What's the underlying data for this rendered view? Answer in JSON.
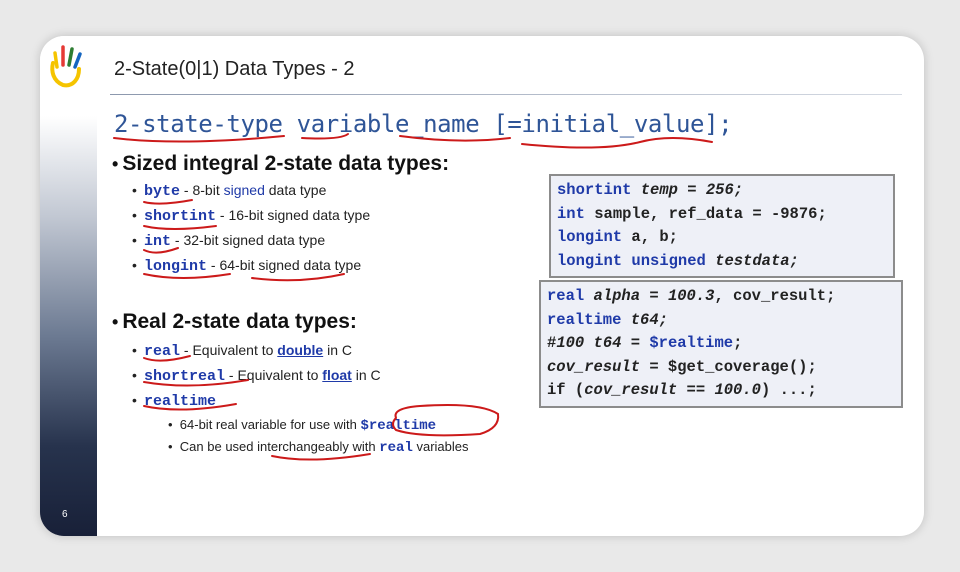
{
  "slide": {
    "page_number": "6",
    "title": "2-State(0|1) Data Types - 2",
    "syntax": "2-state-type variable_name [=initial_value];"
  },
  "sized": {
    "heading": "Sized  integral 2-state data types:",
    "items": [
      {
        "kw": "byte",
        "sep": " - ",
        "pre": "8-bit ",
        "colored": "signed",
        "post": " data type"
      },
      {
        "kw": "shortint",
        "sep": " - ",
        "pre": "16-bit",
        "colored": "",
        "post": " signed data type"
      },
      {
        "kw": "int",
        "sep": " - ",
        "pre": "32-bit signed",
        "colored": "",
        "post": " data type"
      },
      {
        "kw": "longint",
        "sep": " - ",
        "pre": "64-bit signed",
        "colored": "",
        "post": " data type"
      }
    ]
  },
  "real": {
    "heading": "Real 2-state data types:",
    "items": [
      {
        "kw": "real",
        "text_before": " - Equivalent to ",
        "link": "double",
        "text_after": " in C"
      },
      {
        "kw": "shortreal",
        "text_before": " - Equivalent to ",
        "link": "float",
        "text_after": " in C"
      },
      {
        "kw": "realtime",
        "text_before": "",
        "link": "",
        "text_after": ""
      }
    ],
    "sub_items": [
      {
        "text": "64-bit real variable for use with ",
        "code": "$realtime",
        "after": ""
      },
      {
        "text": "Can be used interchangeably with ",
        "code": "real",
        "after": " variables"
      }
    ]
  },
  "code_box_1": {
    "lines": [
      [
        {
          "t": "shortint ",
          "c": "k"
        },
        {
          "t": "temp",
          "c": "i"
        },
        {
          "t": " = ",
          "c": ""
        },
        {
          "t": "256;",
          "c": "i"
        }
      ],
      [
        {
          "t": "int ",
          "c": "k"
        },
        {
          "t": "sample, ref_data = -9876;",
          "c": ""
        }
      ],
      [
        {
          "t": "longint ",
          "c": "k"
        },
        {
          "t": "a, b;",
          "c": ""
        }
      ],
      [
        {
          "t": "longint unsigned ",
          "c": "k"
        },
        {
          "t": "testdata;",
          "c": "i"
        }
      ]
    ]
  },
  "code_box_2": {
    "lines": [
      [
        {
          "t": "real ",
          "c": "k"
        },
        {
          "t": "alpha",
          "c": "i"
        },
        {
          "t": " = ",
          "c": ""
        },
        {
          "t": "100.3",
          "c": "i"
        },
        {
          "t": ", cov_result;",
          "c": ""
        }
      ],
      [
        {
          "t": "realtime ",
          "c": "k"
        },
        {
          "t": "t64;",
          "c": "i"
        }
      ],
      [
        {
          "t": "#",
          "c": ""
        },
        {
          "t": "100 t64",
          "c": "i"
        },
        {
          "t": " = ",
          "c": ""
        },
        {
          "t": "$realtime",
          "c": "k"
        },
        {
          "t": ";",
          "c": ""
        }
      ],
      [
        {
          "t": "cov_result",
          "c": "i"
        },
        {
          "t": " = $get_coverage();",
          "c": ""
        }
      ],
      [
        {
          "t": "if (",
          "c": ""
        },
        {
          "t": "cov_result",
          "c": "i"
        },
        {
          "t": " == ",
          "c": ""
        },
        {
          "t": "100.0",
          "c": "i"
        },
        {
          "t": ") ...;",
          "c": ""
        }
      ]
    ]
  },
  "colors": {
    "accent": "#1f3aa8",
    "annotation_ink": "#cc1a1a",
    "code_bg": "#eef0f7"
  }
}
